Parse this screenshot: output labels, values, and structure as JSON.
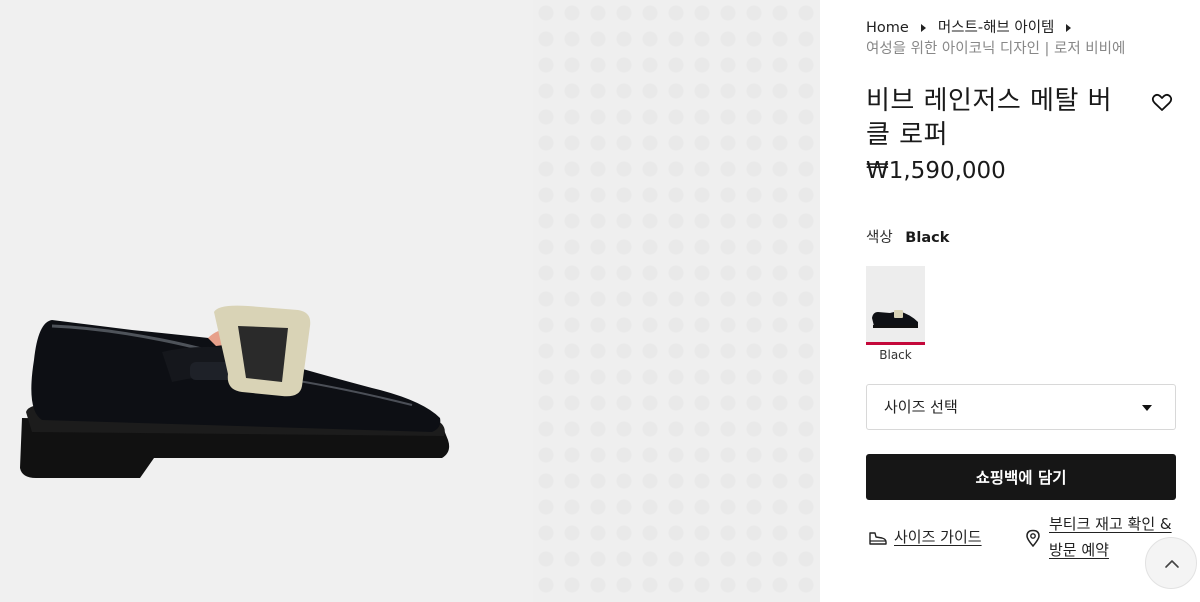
{
  "breadcrumb": {
    "items": [
      "Home",
      "머스트-해브 아이템"
    ],
    "current": "여성을 위한 아이코닉 디자인 | 로저 비비에"
  },
  "product": {
    "title": "비브 레인저스 메탈 버클 로퍼",
    "price": "₩1,590,000",
    "color_label": "색상",
    "color_value": "Black",
    "swatches": [
      {
        "label": "Black",
        "selected": true
      }
    ]
  },
  "size_select": {
    "placeholder": "사이즈 선택"
  },
  "actions": {
    "add_to_bag": "쇼핑백에 담기",
    "size_guide": "사이즈 가이드",
    "boutique_stock": "부티크 재고 확인 & 방문 예약"
  },
  "icons": {
    "wishlist": "heart-icon",
    "size_guide": "shoe-icon",
    "boutique": "location-pin-icon",
    "scroll_top": "chevron-up-icon"
  },
  "colors": {
    "button_bg": "#161616",
    "swatch_selected": "#c4083a",
    "gallery_bg": "#efefef"
  }
}
